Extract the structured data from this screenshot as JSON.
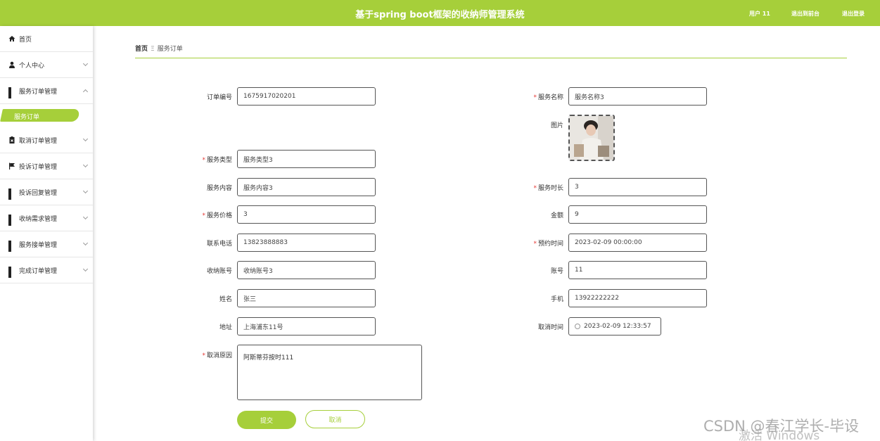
{
  "header": {
    "title": "基于spring boot框架的收纳师管理系统",
    "user": "用户 11",
    "back_home": "退出到前台",
    "logout": "退出登录",
    "accent": "#a6cf3a"
  },
  "sidebar": {
    "items": [
      {
        "label": "首页",
        "icon": "home-icon"
      },
      {
        "label": "个人中心",
        "icon": "user-icon"
      },
      {
        "label": "服务订单管理",
        "icon": "grid-icon"
      },
      {
        "label": "取消订单管理",
        "icon": "clipboard-icon"
      },
      {
        "label": "投诉订单管理",
        "icon": "flag-icon"
      },
      {
        "label": "投诉回复管理",
        "icon": "grid-icon"
      },
      {
        "label": "收纳需求管理",
        "icon": "grid-icon"
      },
      {
        "label": "服务接单管理",
        "icon": "grid-icon"
      },
      {
        "label": "完成订单管理",
        "icon": "grid-icon"
      }
    ],
    "active_sub": "服务订单"
  },
  "breadcrumb": {
    "home": "首页",
    "sep": "Ξ",
    "current": "服务订单"
  },
  "form": {
    "order_no": {
      "label": "订单编号",
      "value": "1675917020201"
    },
    "service_name": {
      "label": "服务名称",
      "value": "服务名称3"
    },
    "image": {
      "label": "图片"
    },
    "service_type": {
      "label": "服务类型",
      "value": "服务类型3"
    },
    "service_content": {
      "label": "服务内容",
      "value": "服务内容3"
    },
    "service_duration": {
      "label": "服务时长",
      "value": "3"
    },
    "service_price": {
      "label": "服务价格",
      "value": "3"
    },
    "amount": {
      "label": "金额",
      "value": "9"
    },
    "phone": {
      "label": "联系电话",
      "value": "13823888883"
    },
    "appointment_time": {
      "label": "预约时间",
      "value": "2023-02-09 00:00:00"
    },
    "storage_account": {
      "label": "收纳账号",
      "value": "收纳账号3"
    },
    "account": {
      "label": "账号",
      "value": "11"
    },
    "name": {
      "label": "姓名",
      "value": "张三"
    },
    "mobile": {
      "label": "手机",
      "value": "13922222222"
    },
    "address": {
      "label": "地址",
      "value": "上海浦东11号"
    },
    "cancel_time": {
      "label": "取消时间",
      "value": "2023-02-09 12:33:57"
    },
    "cancel_reason": {
      "label": "取消原因",
      "value": "阿斯蒂芬按时111"
    }
  },
  "buttons": {
    "submit": "提交",
    "cancel": "取消"
  },
  "watermark": {
    "csdn": "CSDN @春江学长-毕设",
    "windows": "激活 Windows"
  }
}
